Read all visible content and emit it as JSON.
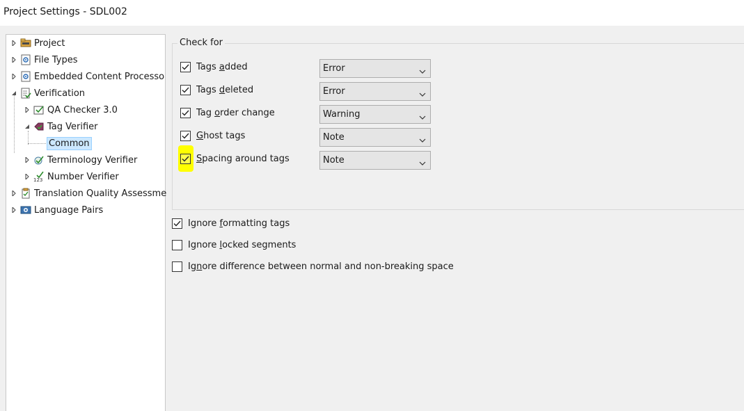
{
  "window": {
    "title": "Project Settings - SDL002"
  },
  "tree": {
    "items": [
      {
        "label": "Project",
        "icon": "project-icon"
      },
      {
        "label": "File Types",
        "icon": "file-types-icon"
      },
      {
        "label": "Embedded Content Processo",
        "icon": "embedded-content-icon"
      },
      {
        "label": "Verification",
        "icon": "verification-icon"
      },
      {
        "label": "QA Checker 3.0",
        "icon": "qa-checker-icon"
      },
      {
        "label": "Tag Verifier",
        "icon": "tag-verifier-icon"
      },
      {
        "label": "Common",
        "selected": true
      },
      {
        "label": "Terminology Verifier",
        "icon": "terminology-verifier-icon"
      },
      {
        "label": "Number Verifier",
        "icon": "number-verifier-icon"
      },
      {
        "label": "Translation Quality Assessme",
        "icon": "tqa-icon"
      },
      {
        "label": "Language Pairs",
        "icon": "language-pairs-icon"
      }
    ]
  },
  "checkfor": {
    "legend": "Check for",
    "rows": [
      {
        "pre": "Tags ",
        "acc": "a",
        "post": "dded",
        "checked": true,
        "severity": "Error"
      },
      {
        "pre": "Tags ",
        "acc": "d",
        "post": "eleted",
        "checked": true,
        "severity": "Error"
      },
      {
        "pre": "Tag ",
        "acc": "o",
        "post": "rder change",
        "checked": true,
        "severity": "Warning"
      },
      {
        "pre": "",
        "acc": "G",
        "post": "host tags",
        "checked": true,
        "severity": "Note"
      },
      {
        "pre": "",
        "acc": "S",
        "post": "pacing around tags",
        "checked": true,
        "severity": "Note",
        "highlight": "#ffff00"
      }
    ]
  },
  "options": [
    {
      "pre": "Ignore ",
      "acc": "f",
      "post": "ormatting tags",
      "checked": true
    },
    {
      "pre": "Ignore ",
      "acc": "l",
      "post": "ocked segments",
      "checked": false
    },
    {
      "pre": "Ig",
      "acc": "n",
      "post": "ore difference between normal and non-breaking space",
      "checked": false
    }
  ]
}
